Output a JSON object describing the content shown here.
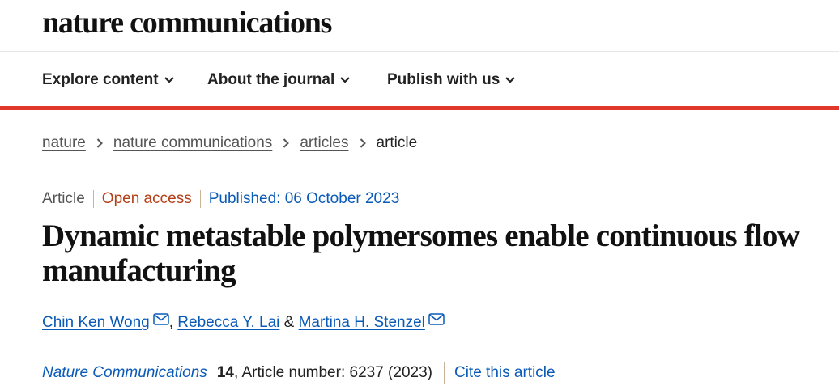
{
  "header": {
    "logo": "nature communications"
  },
  "nav": {
    "items": [
      {
        "label": "Explore content"
      },
      {
        "label": "About the journal"
      },
      {
        "label": "Publish with us"
      }
    ]
  },
  "breadcrumb": {
    "items": [
      "nature",
      "nature communications",
      "articles"
    ],
    "current": "article"
  },
  "article": {
    "type": "Article",
    "access": "Open access",
    "published": "Published: 06 October 2023",
    "title": "Dynamic metastable polymersomes enable continuous flow manufacturing",
    "authors": {
      "author1": "Chin Ken Wong",
      "sep1": ", ",
      "author2": "Rebecca Y. Lai",
      "sep2": " & ",
      "author3": "Martina H. Stenzel"
    },
    "citation": {
      "journal": "Nature Communications",
      "volume": "14",
      "details": ", Article number: 6237 (2023)",
      "cite_label": "Cite this article"
    }
  },
  "colors": {
    "accent_red": "#e0392b",
    "link_blue": "#0a5ab7",
    "open_access": "#b43f19"
  },
  "icons": [
    "chevron-down-icon",
    "chevron-right-icon",
    "mail-icon"
  ]
}
